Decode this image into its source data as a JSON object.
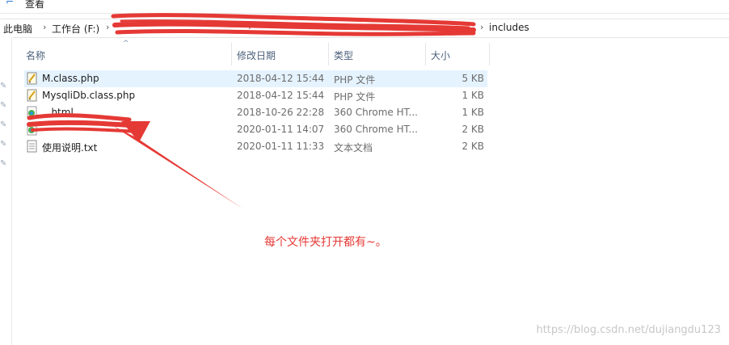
{
  "ribbon": {
    "view_tab": "查看"
  },
  "address": {
    "crumbs": [
      "此电脑",
      "工作台 (F:)",
      "includes"
    ]
  },
  "columns": {
    "name": "名称",
    "date": "修改日期",
    "type": "类型",
    "size": "大小"
  },
  "files": [
    {
      "name": "M.class.php",
      "date": "2018-04-12 15:44",
      "type": "PHP 文件",
      "size": "5 KB",
      "icon": "php-file-icon",
      "selected": true
    },
    {
      "name": "MysqliDb.class.php",
      "date": "2018-04-12 15:44",
      "type": "PHP 文件",
      "size": "1 KB",
      "icon": "php-file-icon",
      "selected": false
    },
    {
      "name": "...html",
      "date": "2018-10-26 22:28",
      "type": "360 Chrome HT...",
      "size": "1 KB",
      "icon": "chrome-html-icon",
      "selected": false
    },
    {
      "name": "",
      "date": "2020-01-11 14:07",
      "type": "360 Chrome HT...",
      "size": "2 KB",
      "icon": "chrome-html-icon",
      "selected": false
    },
    {
      "name": "使用说明.txt",
      "date": "2020-01-11 11:33",
      "type": "文本文档",
      "size": "2 KB",
      "icon": "text-file-icon",
      "selected": false
    }
  ],
  "annotation": "每个文件夹打开都有~。",
  "watermark": "https://blog.csdn.net/dujiangdu123",
  "colors": {
    "scribble": "#e53935",
    "selection": "#e5f3ff",
    "header_text": "#4c607a"
  }
}
